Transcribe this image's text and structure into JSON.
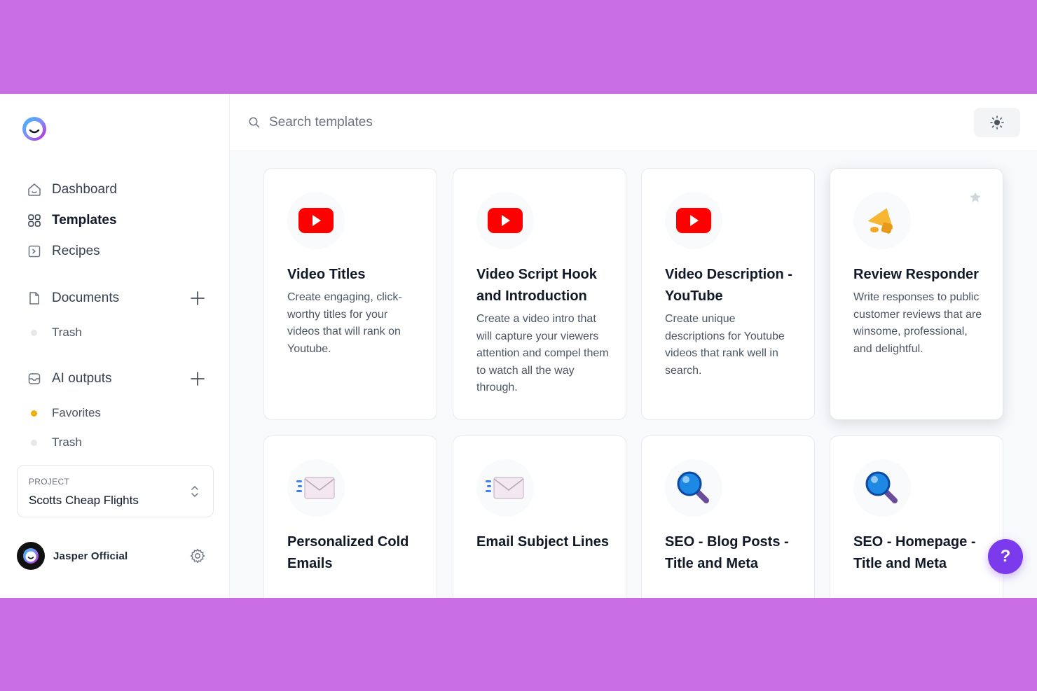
{
  "sidebar": {
    "nav": [
      {
        "label": "Dashboard",
        "icon": "home-icon"
      },
      {
        "label": "Templates",
        "icon": "grid-icon"
      },
      {
        "label": "Recipes",
        "icon": "recipe-icon"
      }
    ],
    "documents": {
      "label": "Documents",
      "trash": "Trash"
    },
    "ai_outputs": {
      "label": "AI outputs",
      "favorites": "Favorites",
      "trash": "Trash"
    },
    "project": {
      "caption": "PROJECT",
      "name": "Scotts Cheap Flights"
    },
    "user": {
      "name": "Jasper Official"
    }
  },
  "search": {
    "placeholder": "Search templates"
  },
  "cards": [
    {
      "title": "Video Titles",
      "description": "Create engaging, click-worthy titles for your videos that will rank on Youtube.",
      "icon": "youtube-icon"
    },
    {
      "title": "Video Script Hook and Introduction",
      "description": "Create a video intro that will capture your viewers attention and compel them to watch all the way through.",
      "icon": "youtube-icon"
    },
    {
      "title": "Video Description - YouTube",
      "description": "Create unique descriptions for Youtube videos that rank well in search.",
      "icon": "youtube-icon"
    },
    {
      "title": "Review Responder",
      "description": "Write responses to public customer reviews that are winsome, professional, and delightful.",
      "icon": "megaphone-icon"
    },
    {
      "title": "Personalized Cold Emails",
      "description": "",
      "icon": "email-icon"
    },
    {
      "title": "Email Subject Lines",
      "description": "",
      "icon": "email-icon"
    },
    {
      "title": "SEO - Blog Posts - Title and Meta",
      "description": "",
      "icon": "magnifier-icon"
    },
    {
      "title": "SEO - Homepage - Title and Meta",
      "description": "",
      "icon": "magnifier-icon"
    }
  ],
  "help": {
    "label": "?"
  },
  "colors": {
    "accent": "#7c3aed",
    "frame": "#c96de4",
    "youtube": "#ff0000",
    "favorite": "#eab308"
  }
}
